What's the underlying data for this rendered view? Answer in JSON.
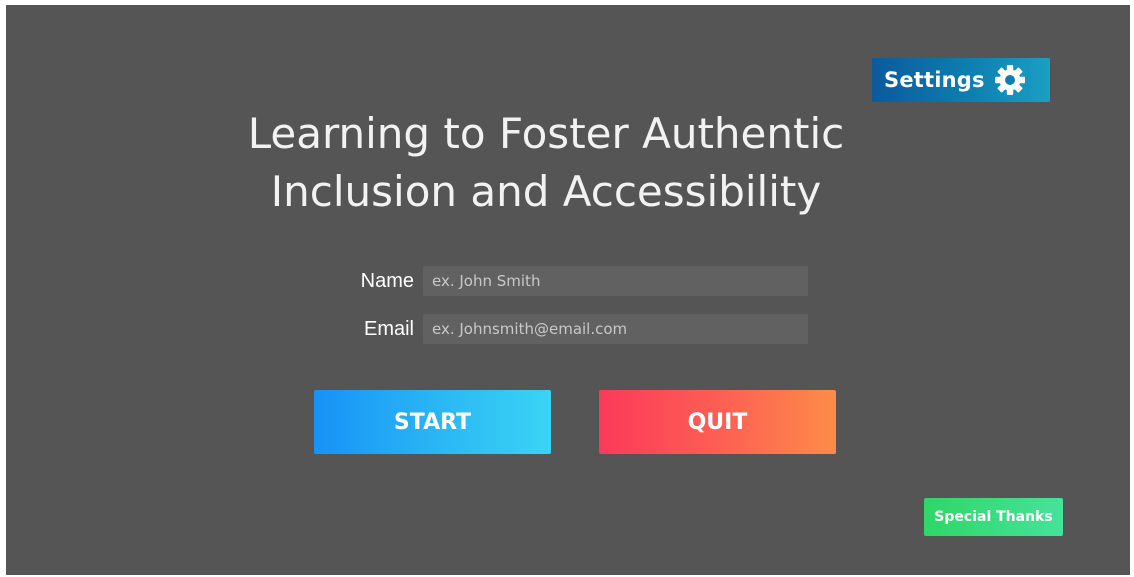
{
  "settings": {
    "label": "Settings",
    "icon": "gear-icon"
  },
  "title": {
    "line1": "Learning to Foster Authentic",
    "line2": "Inclusion and Accessibility"
  },
  "form": {
    "name": {
      "label": "Name",
      "value": "",
      "placeholder": "ex. John Smith"
    },
    "email": {
      "label": "Email",
      "value": "",
      "placeholder": "ex. Johnsmith@email.com"
    }
  },
  "actions": {
    "start_label": "START",
    "quit_label": "QUIT"
  },
  "footer": {
    "special_thanks_label": "Special Thanks"
  },
  "colors": {
    "background": "#555555",
    "settings_gradient_start": "#0b5a9c",
    "settings_gradient_end": "#1a9fc4",
    "start_gradient_start": "#1792f6",
    "start_gradient_end": "#3ad4f5",
    "quit_gradient_start": "#fb3a5a",
    "quit_gradient_end": "#fd8c48",
    "thanks_gradient_start": "#2fd667",
    "thanks_gradient_end": "#45e39a"
  }
}
